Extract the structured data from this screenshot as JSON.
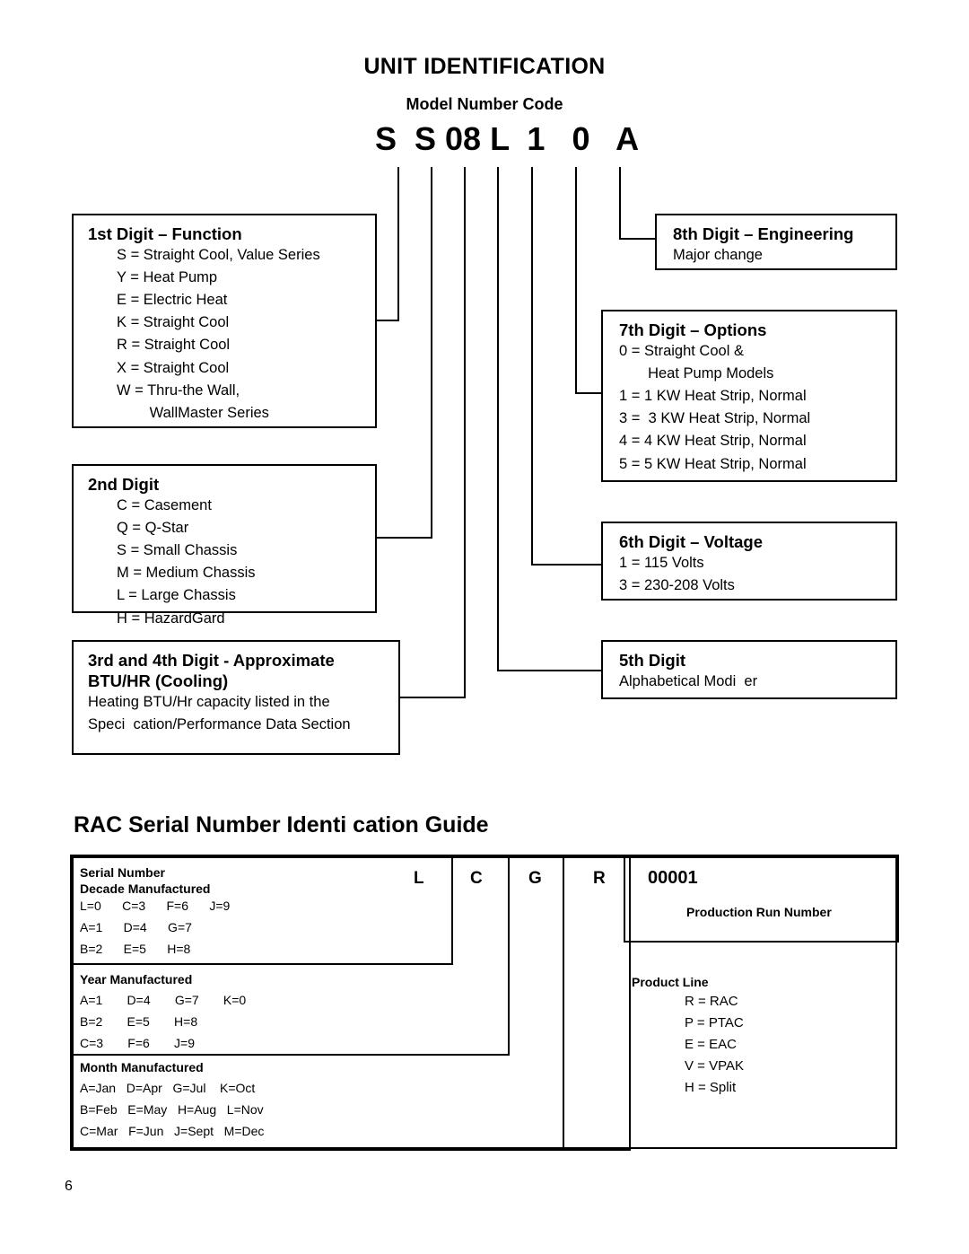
{
  "document": {
    "title": "UNIT IDENTIFICATION",
    "subtitle": "Model Number Code",
    "model_code": "S  S 08 L  1   0   A",
    "page_number": "6"
  },
  "model_boxes": {
    "digit1": {
      "heading": "1st Digit – Function",
      "items": "S = Straight Cool, Value Series\nY = Heat Pump\nE = Electric Heat\nK = Straight Cool\nR = Straight Cool\nX = Straight Cool\nW = Thru-the Wall,\n        WallMaster Series"
    },
    "digit2": {
      "heading": "2nd Digit",
      "items": "C = Casement\nQ = Q-Star\nS = Small Chassis\nM = Medium Chassis\nL = Large Chassis\nH = HazardGard"
    },
    "digit34": {
      "heading": "3rd and 4th Digit - Approximate",
      "heading2": "BTU/HR (Cooling)",
      "items": "Heating BTU/Hr capacity listed in the\nSpeci  cation/Performance Data Section"
    },
    "digit5": {
      "heading": "5th Digit",
      "items": "Alphabetical Modi  er"
    },
    "digit6": {
      "heading": "6th Digit – Voltage",
      "items": "1 = 115 Volts\n3 = 230-208 Volts"
    },
    "digit7": {
      "heading": "7th Digit – Options",
      "items": "0 = Straight Cool &\n       Heat Pump Models\n1 = 1 KW Heat Strip, Normal\n3 =  3 KW Heat Strip, Normal\n4 = 4 KW Heat Strip, Normal\n5 = 5 KW Heat Strip, Normal"
    },
    "digit8": {
      "heading": "8th Digit – Engineering",
      "items": "Major change"
    }
  },
  "serial": {
    "title": "RAC Serial Number Identi  cation Guide",
    "code": {
      "decade": "L",
      "year": "C",
      "month": "G",
      "product_line": "R",
      "run": "00001"
    },
    "decade": {
      "heading": "Serial Number",
      "heading2": "Decade Manufactured",
      "rows": "L=0      C=3      F=6      J=9\nA=1      D=4      G=7\nB=2      E=5      H=8"
    },
    "year": {
      "heading": "Year Manufactured",
      "rows": "A=1       D=4       G=7       K=0\nB=2       E=5       H=8\nC=3       F=6       J=9"
    },
    "month": {
      "heading": "Month Manufactured",
      "rows": "A=Jan   D=Apr   G=Jul    K=Oct\nB=Feb   E=May   H=Aug   L=Nov\nC=Mar   F=Jun   J=Sept   M=Dec"
    },
    "production_run": {
      "label": "Production Run Number"
    },
    "product_line": {
      "heading": "Product Line",
      "items": "R = RAC\nP = PTAC\nE = EAC\nV = VPAK\nH = Split"
    }
  },
  "colors": {
    "ink": "#000000",
    "paper": "#ffffff"
  }
}
